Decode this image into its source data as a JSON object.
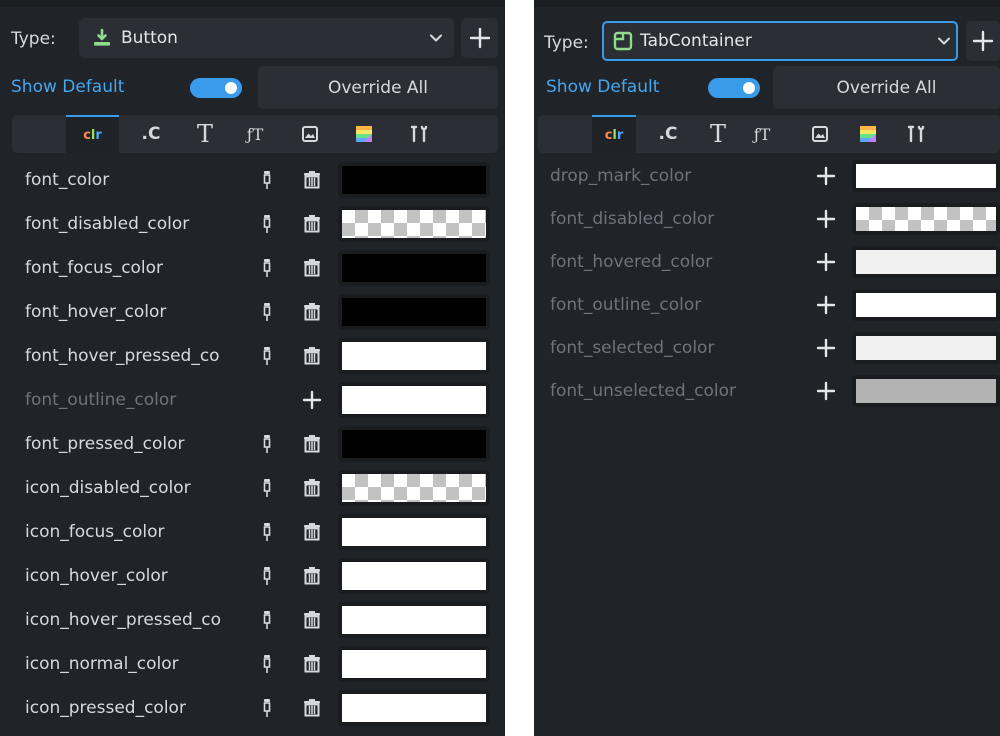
{
  "left": {
    "type_label": "Type:",
    "type_value": "Button",
    "show_default": "Show Default",
    "override_all": "Override All",
    "tabs": [
      "clr",
      ".C",
      "T",
      "fT",
      "image",
      "stylebox",
      "constants"
    ],
    "active_tab": "clr",
    "rows": [
      {
        "name": "font_color",
        "overridden": true,
        "swatch": "#000000"
      },
      {
        "name": "font_disabled_color",
        "overridden": true,
        "swatch": "checker"
      },
      {
        "name": "font_focus_color",
        "overridden": true,
        "swatch": "#000000"
      },
      {
        "name": "font_hover_color",
        "overridden": true,
        "swatch": "#000000"
      },
      {
        "name": "font_hover_pressed_co",
        "overridden": true,
        "swatch": "#ffffff"
      },
      {
        "name": "font_outline_color",
        "overridden": false,
        "swatch": "#ffffff"
      },
      {
        "name": "font_pressed_color",
        "overridden": true,
        "swatch": "#000000"
      },
      {
        "name": "icon_disabled_color",
        "overridden": true,
        "swatch": "checker"
      },
      {
        "name": "icon_focus_color",
        "overridden": true,
        "swatch": "#ffffff"
      },
      {
        "name": "icon_hover_color",
        "overridden": true,
        "swatch": "#ffffff"
      },
      {
        "name": "icon_hover_pressed_co",
        "overridden": true,
        "swatch": "#ffffff"
      },
      {
        "name": "icon_normal_color",
        "overridden": true,
        "swatch": "#ffffff"
      },
      {
        "name": "icon_pressed_color",
        "overridden": true,
        "swatch": "#ffffff"
      }
    ]
  },
  "right": {
    "type_label": "Type:",
    "type_value": "TabContainer",
    "show_default": "Show Default",
    "override_all": "Override All",
    "tabs": [
      "clr",
      ".C",
      "T",
      "fT",
      "image",
      "stylebox",
      "constants"
    ],
    "active_tab": "clr",
    "rows": [
      {
        "name": "drop_mark_color",
        "overridden": false,
        "swatch": "#ffffff"
      },
      {
        "name": "font_disabled_color",
        "overridden": false,
        "swatch": "checker"
      },
      {
        "name": "font_hovered_color",
        "overridden": false,
        "swatch": "#f0f0f0"
      },
      {
        "name": "font_outline_color",
        "overridden": false,
        "swatch": "#ffffff"
      },
      {
        "name": "font_selected_color",
        "overridden": false,
        "swatch": "#f0f0f0"
      },
      {
        "name": "font_unselected_color",
        "overridden": false,
        "swatch": "#b3b3b3"
      }
    ]
  },
  "colors": {
    "accent": "#3a9bea",
    "button_icon": "#8edb8c",
    "panel_bg": "#202328",
    "row_bg": "#262a30",
    "label_default": "#6e737c"
  },
  "icons": {
    "pin": "pin-icon",
    "trash": "trash-icon",
    "plus": "plus-icon",
    "chevron": "chevron-down-icon",
    "button_type": "button-node-icon",
    "tab_container_type": "tab-container-node-icon"
  }
}
